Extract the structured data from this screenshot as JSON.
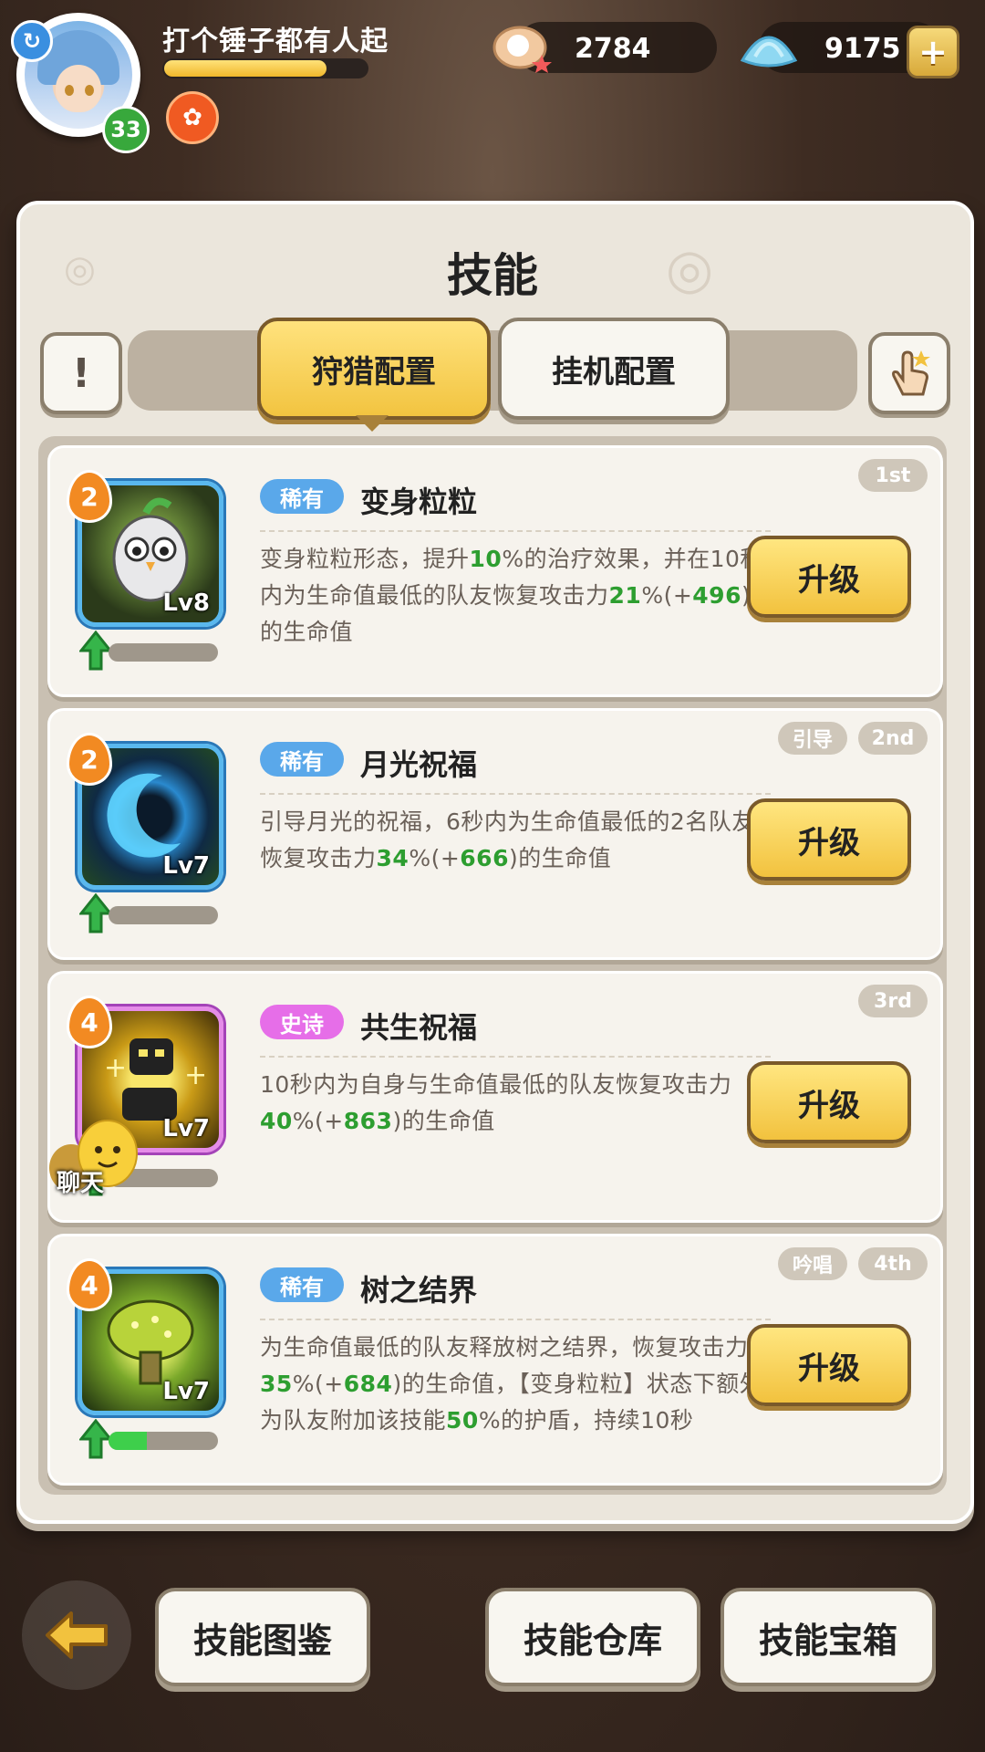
{
  "player": {
    "name": "打个锤子都有人起",
    "level": "33",
    "xp_fraction": 0.8
  },
  "resources": {
    "pearls": "2784",
    "shells": "9175"
  },
  "title": "技能",
  "tabs": {
    "active": "狩猎配置",
    "idle": "挂机配置"
  },
  "skills": [
    {
      "stars": "2",
      "level": "Lv8",
      "rarity": "稀有",
      "name": "变身粒粒",
      "rank": "1st",
      "type": "",
      "desc_html": "变身粒粒形态，提升<span class='g'>10</span>%的治疗效果，并在10秒内为生命值最低的队友恢复攻击力<span class='g'>21</span>%(+<span class='g'>496</span>)的生命值",
      "progress": 0.0,
      "upgrade": "升级"
    },
    {
      "stars": "2",
      "level": "Lv7",
      "rarity": "稀有",
      "name": "月光祝福",
      "rank": "2nd",
      "type": "引导",
      "desc_html": "引导月光的祝福，6秒内为生命值最低的2名队友恢复攻击力<span class='g'>34</span>%(+<span class='g'>666</span>)的生命值",
      "progress": 0.0,
      "upgrade": "升级"
    },
    {
      "stars": "4",
      "level": "Lv7",
      "rarity": "史诗",
      "name": "共生祝福",
      "rank": "3rd",
      "type": "",
      "desc_html": "10秒内为自身与生命值最低的队友恢复攻击力<span class='g'>40</span>%(+<span class='g'>863</span>)的生命值",
      "progress": 0.0,
      "upgrade": "升级"
    },
    {
      "stars": "4",
      "level": "Lv7",
      "rarity": "稀有",
      "name": "树之结界",
      "rank": "4th",
      "type": "吟唱",
      "desc_html": "为生命值最低的队友释放树之结界，恢复攻击力<span class='g'>35</span>%(+<span class='g'>684</span>)的生命值，【变身粒粒】状态下额外为队友附加该技能<span class='g'>50</span>%的护盾，持续10秒",
      "progress": 0.35,
      "upgrade": "升级"
    }
  ],
  "chat_label": "聊天",
  "bottom": {
    "codex": "技能图鉴",
    "warehouse": "技能仓库",
    "chest": "技能宝箱"
  },
  "colors": {
    "rare": "#5aa8ea",
    "epic": "#e66ee8",
    "highlight": "#2d9e30",
    "button": "#f2c23e"
  }
}
